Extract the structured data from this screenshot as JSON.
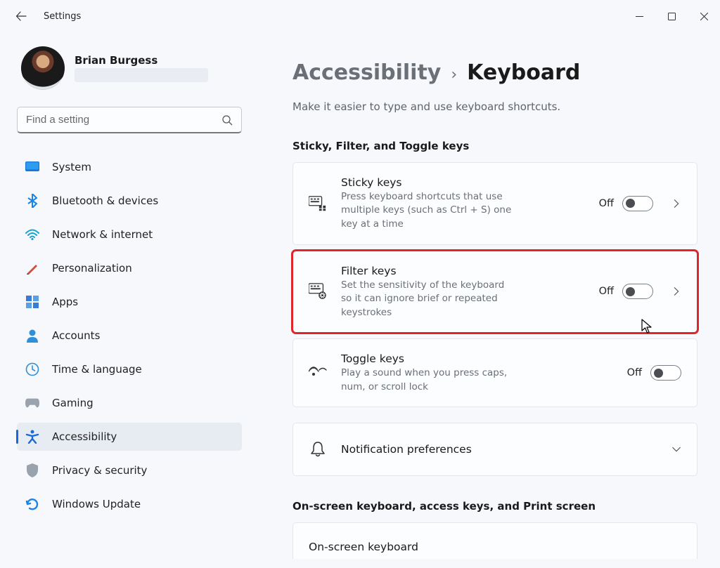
{
  "app": {
    "title": "Settings"
  },
  "user": {
    "name": "Brian Burgess"
  },
  "search": {
    "placeholder": "Find a setting"
  },
  "sidebar": {
    "items": [
      {
        "label": "System"
      },
      {
        "label": "Bluetooth & devices"
      },
      {
        "label": "Network & internet"
      },
      {
        "label": "Personalization"
      },
      {
        "label": "Apps"
      },
      {
        "label": "Accounts"
      },
      {
        "label": "Time & language"
      },
      {
        "label": "Gaming"
      },
      {
        "label": "Accessibility"
      },
      {
        "label": "Privacy & security"
      },
      {
        "label": "Windows Update"
      }
    ]
  },
  "page": {
    "parent": "Accessibility",
    "current": "Keyboard",
    "subtitle": "Make it easier to type and use keyboard shortcuts.",
    "sections": [
      {
        "heading": "Sticky, Filter, and Toggle keys",
        "items": [
          {
            "title": "Sticky keys",
            "desc": "Press keyboard shortcuts that use multiple keys (such as Ctrl + S) one key at a time",
            "state": "Off"
          },
          {
            "title": "Filter keys",
            "desc": "Set the sensitivity of the keyboard so it can ignore brief or repeated keystrokes",
            "state": "Off"
          },
          {
            "title": "Toggle keys",
            "desc": "Play a sound when you press caps, num, or scroll lock",
            "state": "Off"
          }
        ],
        "extra": {
          "title": "Notification preferences"
        }
      },
      {
        "heading": "On-screen keyboard, access keys, and Print screen",
        "items": [
          {
            "title": "On-screen keyboard"
          }
        ]
      }
    ]
  }
}
